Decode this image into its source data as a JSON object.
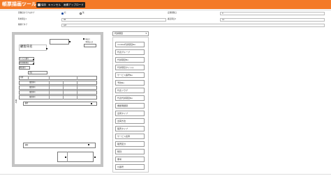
{
  "app": {
    "title": "帳票描画ツール"
  },
  "toolbar": {
    "save_label": "保存",
    "cancel_label": "キャンセル",
    "upload_label": "画像アップロード"
  },
  "settings": {
    "row1": {
      "label": "画像出力モクロタブ",
      "radio_yes": "有",
      "radio_no": "無",
      "right_label": "定期期限日",
      "right_value": "0"
    },
    "row2": {
      "label": "利用期日1",
      "value": "90",
      "right_label": "確定期日2",
      "right_value": "12"
    },
    "row3": {
      "label": "種類ナタブ",
      "value": "ppt"
    }
  },
  "form": {
    "top_label_1": "申込日",
    "top_label_2": "予約加入日",
    "name": "顧客氏名",
    "field_service": "サービス番号",
    "field_contract": "利用期限期日",
    "field_area": "地区番号",
    "field_label_a": "氏名",
    "field_label_b": "住所",
    "field_phone_1": "電話番号",
    "field_phone_2": "電話番号",
    "field_phone_3": "電話番号",
    "field_phone_4": "電話番号",
    "side_label": "備考",
    "remarks": "備考",
    "bottom_label": "摘要"
  },
  "palette": {
    "select_value": "代替項目",
    "items": [
      "mobile代替項目No",
      "代表グループ",
      "代替項目No",
      "代替項目タイトル",
      "サービス番号No",
      "予約No",
      "代表フラグ",
      "代表代替項目No",
      "機能明細項",
      "出荷タイプ",
      "出荷方法",
      "販売タイプ",
      "サービス名称",
      "販売区分",
      "時刻",
      "備考",
      "付番号"
    ]
  }
}
